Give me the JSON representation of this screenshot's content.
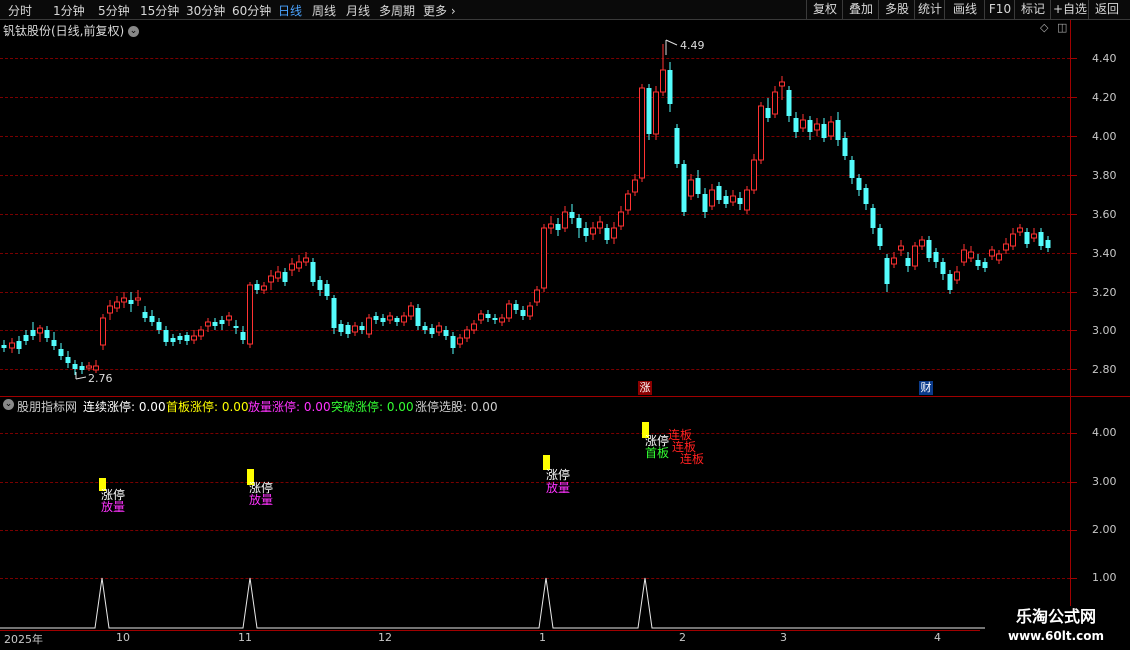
{
  "toolbar": {
    "periods": [
      "分时",
      "1分钟",
      "5分钟",
      "15分钟",
      "30分钟",
      "60分钟",
      "日线",
      "周线",
      "月线",
      "多周期",
      "更多"
    ],
    "active_period": "日线",
    "right_buttons": [
      "复权",
      "叠加",
      "多股",
      "统计",
      "画线",
      "F10",
      "标记",
      "+自选",
      "返回"
    ]
  },
  "main_panel": {
    "title": "钒钛股份(日线,前复权)",
    "y_labels": [
      "4.40",
      "4.20",
      "4.00",
      "3.80",
      "3.60",
      "3.40",
      "3.20",
      "3.00",
      "2.80"
    ],
    "high_marker": "4.49",
    "low_marker": "2.76",
    "badge_zhang": "涨",
    "badge_cai": "财"
  },
  "indicator_panel": {
    "legend": [
      {
        "label": "股朋指标网",
        "color": "#cfcfcf"
      },
      {
        "label": "连续涨停: 0.00",
        "color": "#ffffff"
      },
      {
        "label": "首板涨停: 0.00",
        "color": "#ffff00"
      },
      {
        "label": "放量涨停: 0.00",
        "color": "#ff33ff"
      },
      {
        "label": "突破涨停: 0.00",
        "color": "#33ff33"
      },
      {
        "label": "涨停选股: 0.00",
        "color": "#cfcfcf"
      }
    ],
    "y_labels": [
      "4.00",
      "3.00",
      "2.00",
      "1.00"
    ],
    "signal_texts": {
      "zt": "涨停",
      "fl": "放量",
      "sb": "首板",
      "lb": "连板"
    }
  },
  "x_axis": {
    "labels": [
      "2025年",
      "10",
      "11",
      "12",
      "1",
      "2",
      "3",
      "4"
    ]
  },
  "watermark": {
    "title": "乐淘公式网",
    "url": "www.60lt.com"
  },
  "colors": {
    "up": "#ff3232",
    "down": "#54fcfc",
    "grid": "#7a0000",
    "axis": "#a00000"
  }
}
